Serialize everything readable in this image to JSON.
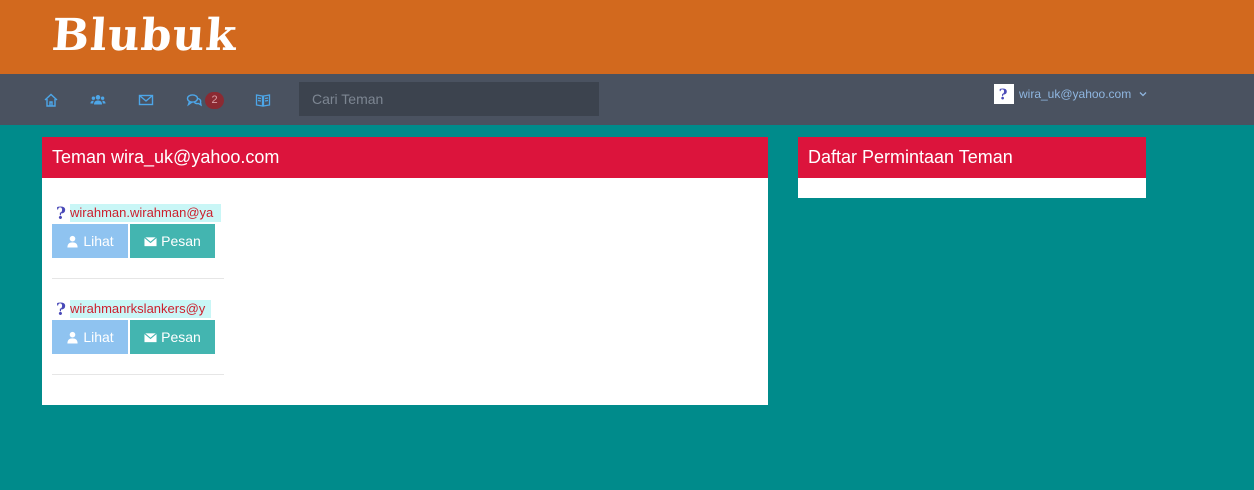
{
  "app": {
    "logo": "Blubuk"
  },
  "nav": {
    "icons": [
      "home-icon",
      "users-icon",
      "mail-icon",
      "chat-icon",
      "book-icon"
    ],
    "chat_badge": "2",
    "search_placeholder": "Cari Teman",
    "user_email": "wira_uk@yahoo.com"
  },
  "friends_panel": {
    "title": "Teman wira_uk@yahoo.com",
    "friends": [
      {
        "name": "wirahman.wirahman@ya",
        "view_label": "Lihat",
        "message_label": "Pesan"
      },
      {
        "name": "wirahmanrkslankers@y",
        "view_label": "Lihat",
        "message_label": "Pesan"
      }
    ]
  },
  "requests_panel": {
    "title": "Daftar Permintaan Teman"
  },
  "colors": {
    "header": "#d2691e",
    "navbar": "#4a5260",
    "background": "#008b8b",
    "panel_header": "#dc143c",
    "view_button": "#8fc3f0",
    "message_button": "#43b5b0"
  }
}
